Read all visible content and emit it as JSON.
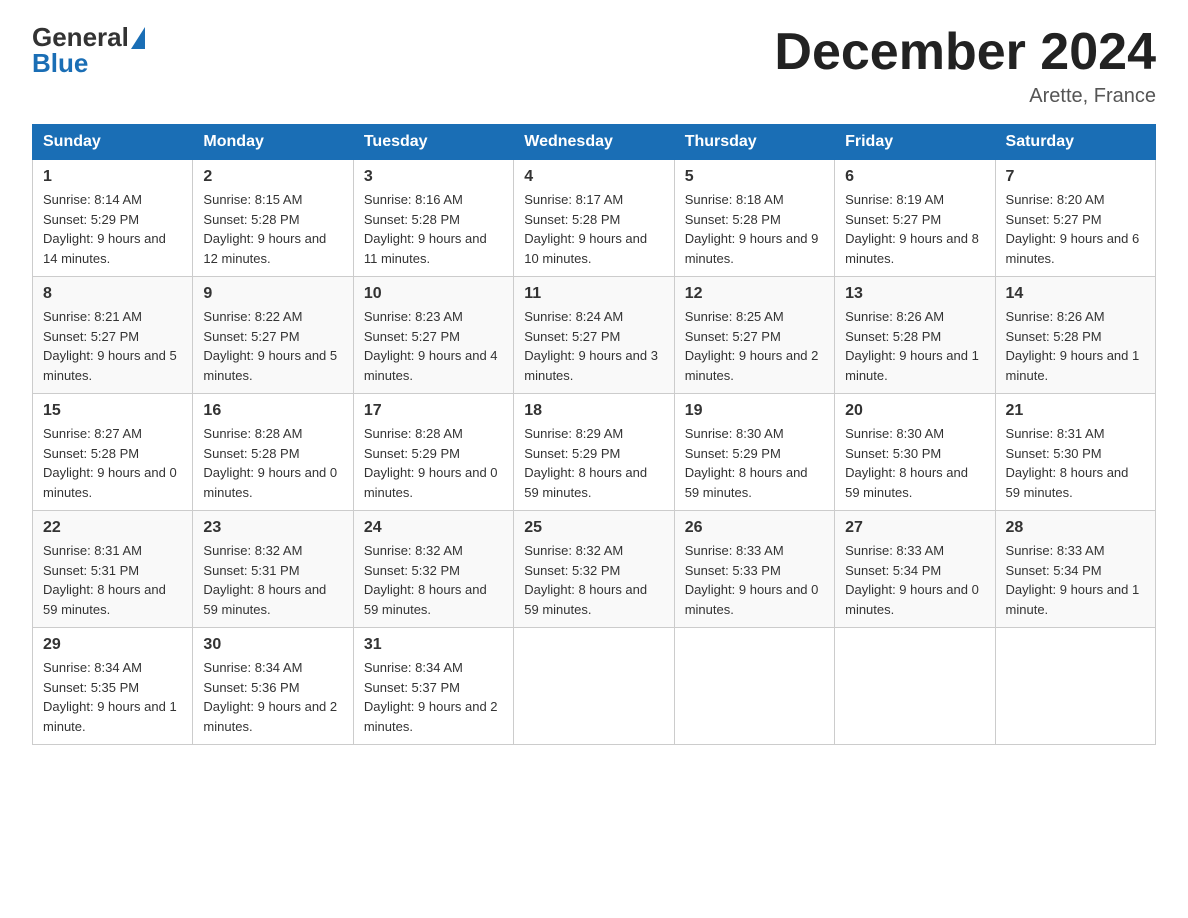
{
  "header": {
    "title": "December 2024",
    "location": "Arette, France"
  },
  "days_header": [
    "Sunday",
    "Monday",
    "Tuesday",
    "Wednesday",
    "Thursday",
    "Friday",
    "Saturday"
  ],
  "weeks": [
    [
      {
        "num": "1",
        "sunrise": "8:14 AM",
        "sunset": "5:29 PM",
        "daylight": "9 hours and 14 minutes."
      },
      {
        "num": "2",
        "sunrise": "8:15 AM",
        "sunset": "5:28 PM",
        "daylight": "9 hours and 12 minutes."
      },
      {
        "num": "3",
        "sunrise": "8:16 AM",
        "sunset": "5:28 PM",
        "daylight": "9 hours and 11 minutes."
      },
      {
        "num": "4",
        "sunrise": "8:17 AM",
        "sunset": "5:28 PM",
        "daylight": "9 hours and 10 minutes."
      },
      {
        "num": "5",
        "sunrise": "8:18 AM",
        "sunset": "5:28 PM",
        "daylight": "9 hours and 9 minutes."
      },
      {
        "num": "6",
        "sunrise": "8:19 AM",
        "sunset": "5:27 PM",
        "daylight": "9 hours and 8 minutes."
      },
      {
        "num": "7",
        "sunrise": "8:20 AM",
        "sunset": "5:27 PM",
        "daylight": "9 hours and 6 minutes."
      }
    ],
    [
      {
        "num": "8",
        "sunrise": "8:21 AM",
        "sunset": "5:27 PM",
        "daylight": "9 hours and 5 minutes."
      },
      {
        "num": "9",
        "sunrise": "8:22 AM",
        "sunset": "5:27 PM",
        "daylight": "9 hours and 5 minutes."
      },
      {
        "num": "10",
        "sunrise": "8:23 AM",
        "sunset": "5:27 PM",
        "daylight": "9 hours and 4 minutes."
      },
      {
        "num": "11",
        "sunrise": "8:24 AM",
        "sunset": "5:27 PM",
        "daylight": "9 hours and 3 minutes."
      },
      {
        "num": "12",
        "sunrise": "8:25 AM",
        "sunset": "5:27 PM",
        "daylight": "9 hours and 2 minutes."
      },
      {
        "num": "13",
        "sunrise": "8:26 AM",
        "sunset": "5:28 PM",
        "daylight": "9 hours and 1 minute."
      },
      {
        "num": "14",
        "sunrise": "8:26 AM",
        "sunset": "5:28 PM",
        "daylight": "9 hours and 1 minute."
      }
    ],
    [
      {
        "num": "15",
        "sunrise": "8:27 AM",
        "sunset": "5:28 PM",
        "daylight": "9 hours and 0 minutes."
      },
      {
        "num": "16",
        "sunrise": "8:28 AM",
        "sunset": "5:28 PM",
        "daylight": "9 hours and 0 minutes."
      },
      {
        "num": "17",
        "sunrise": "8:28 AM",
        "sunset": "5:29 PM",
        "daylight": "9 hours and 0 minutes."
      },
      {
        "num": "18",
        "sunrise": "8:29 AM",
        "sunset": "5:29 PM",
        "daylight": "8 hours and 59 minutes."
      },
      {
        "num": "19",
        "sunrise": "8:30 AM",
        "sunset": "5:29 PM",
        "daylight": "8 hours and 59 minutes."
      },
      {
        "num": "20",
        "sunrise": "8:30 AM",
        "sunset": "5:30 PM",
        "daylight": "8 hours and 59 minutes."
      },
      {
        "num": "21",
        "sunrise": "8:31 AM",
        "sunset": "5:30 PM",
        "daylight": "8 hours and 59 minutes."
      }
    ],
    [
      {
        "num": "22",
        "sunrise": "8:31 AM",
        "sunset": "5:31 PM",
        "daylight": "8 hours and 59 minutes."
      },
      {
        "num": "23",
        "sunrise": "8:32 AM",
        "sunset": "5:31 PM",
        "daylight": "8 hours and 59 minutes."
      },
      {
        "num": "24",
        "sunrise": "8:32 AM",
        "sunset": "5:32 PM",
        "daylight": "8 hours and 59 minutes."
      },
      {
        "num": "25",
        "sunrise": "8:32 AM",
        "sunset": "5:32 PM",
        "daylight": "8 hours and 59 minutes."
      },
      {
        "num": "26",
        "sunrise": "8:33 AM",
        "sunset": "5:33 PM",
        "daylight": "9 hours and 0 minutes."
      },
      {
        "num": "27",
        "sunrise": "8:33 AM",
        "sunset": "5:34 PM",
        "daylight": "9 hours and 0 minutes."
      },
      {
        "num": "28",
        "sunrise": "8:33 AM",
        "sunset": "5:34 PM",
        "daylight": "9 hours and 1 minute."
      }
    ],
    [
      {
        "num": "29",
        "sunrise": "8:34 AM",
        "sunset": "5:35 PM",
        "daylight": "9 hours and 1 minute."
      },
      {
        "num": "30",
        "sunrise": "8:34 AM",
        "sunset": "5:36 PM",
        "daylight": "9 hours and 2 minutes."
      },
      {
        "num": "31",
        "sunrise": "8:34 AM",
        "sunset": "5:37 PM",
        "daylight": "9 hours and 2 minutes."
      },
      null,
      null,
      null,
      null
    ]
  ]
}
